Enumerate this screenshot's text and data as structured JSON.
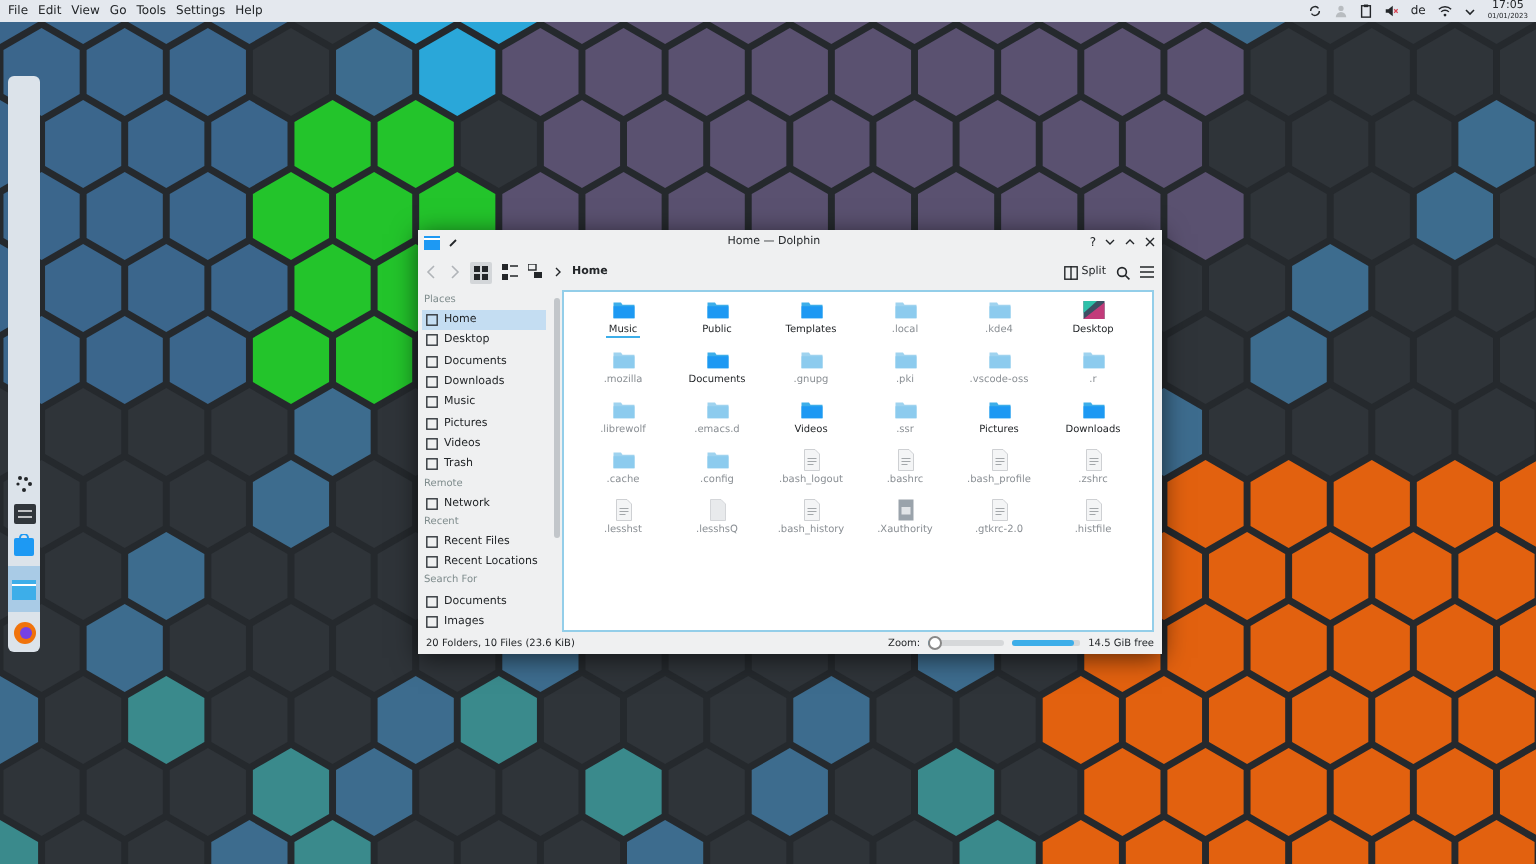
{
  "panel": {
    "menu": [
      "File",
      "Edit",
      "View",
      "Go",
      "Tools",
      "Settings",
      "Help"
    ],
    "keyboard_layout": "de",
    "time": "17:05",
    "date": "01/01/2023"
  },
  "window": {
    "title": "Home — Dolphin",
    "help": "?"
  },
  "toolbar": {
    "breadcrumb": "Home",
    "split": "Split"
  },
  "sidebar": {
    "sections": [
      {
        "title": "Places",
        "items": [
          {
            "label": "Home",
            "selected": true
          },
          {
            "label": "Desktop",
            "selected": false
          },
          {
            "label": "Documents",
            "selected": false
          },
          {
            "label": "Downloads",
            "selected": false
          },
          {
            "label": "Music",
            "selected": false
          },
          {
            "label": "Pictures",
            "selected": false
          },
          {
            "label": "Videos",
            "selected": false
          },
          {
            "label": "Trash",
            "selected": false
          }
        ]
      },
      {
        "title": "Remote",
        "items": [
          {
            "label": "Network",
            "selected": false
          }
        ]
      },
      {
        "title": "Recent",
        "items": [
          {
            "label": "Recent Files",
            "selected": false
          },
          {
            "label": "Recent Locations",
            "selected": false
          }
        ]
      },
      {
        "title": "Search For",
        "items": [
          {
            "label": "Documents",
            "selected": false
          },
          {
            "label": "Images",
            "selected": false
          }
        ]
      }
    ]
  },
  "files": [
    {
      "name": "Music",
      "kind": "folder",
      "hidden": false,
      "selected": true
    },
    {
      "name": "Public",
      "kind": "folder",
      "hidden": false,
      "selected": false
    },
    {
      "name": "Templates",
      "kind": "folder",
      "hidden": false,
      "selected": false
    },
    {
      "name": ".local",
      "kind": "folder",
      "hidden": true,
      "selected": false
    },
    {
      "name": ".kde4",
      "kind": "folder",
      "hidden": true,
      "selected": false
    },
    {
      "name": "Desktop",
      "kind": "desktop",
      "hidden": false,
      "selected": false
    },
    {
      "name": ".mozilla",
      "kind": "folder",
      "hidden": true,
      "selected": false
    },
    {
      "name": "Documents",
      "kind": "folder",
      "hidden": false,
      "selected": false
    },
    {
      "name": ".gnupg",
      "kind": "folder",
      "hidden": true,
      "selected": false
    },
    {
      "name": ".pki",
      "kind": "folder",
      "hidden": true,
      "selected": false
    },
    {
      "name": ".vscode-oss",
      "kind": "folder",
      "hidden": true,
      "selected": false
    },
    {
      "name": ".r",
      "kind": "folder",
      "hidden": true,
      "selected": false
    },
    {
      "name": ".librewolf",
      "kind": "folder",
      "hidden": true,
      "selected": false
    },
    {
      "name": ".emacs.d",
      "kind": "folder",
      "hidden": true,
      "selected": false
    },
    {
      "name": "Videos",
      "kind": "folder",
      "hidden": false,
      "selected": false
    },
    {
      "name": ".ssr",
      "kind": "folder",
      "hidden": true,
      "selected": false
    },
    {
      "name": "Pictures",
      "kind": "folder",
      "hidden": false,
      "selected": false
    },
    {
      "name": "Downloads",
      "kind": "folder",
      "hidden": false,
      "selected": false
    },
    {
      "name": ".cache",
      "kind": "folder",
      "hidden": true,
      "selected": false
    },
    {
      "name": ".config",
      "kind": "folder",
      "hidden": true,
      "selected": false
    },
    {
      "name": ".bash_logout",
      "kind": "file",
      "hidden": true,
      "selected": false
    },
    {
      "name": ".bashrc",
      "kind": "file",
      "hidden": true,
      "selected": false
    },
    {
      "name": ".bash_profile",
      "kind": "file",
      "hidden": true,
      "selected": false
    },
    {
      "name": ".zshrc",
      "kind": "file",
      "hidden": true,
      "selected": false
    },
    {
      "name": ".lesshst",
      "kind": "file",
      "hidden": true,
      "selected": false
    },
    {
      "name": ".lesshsQ",
      "kind": "blank",
      "hidden": true,
      "selected": false
    },
    {
      "name": ".bash_history",
      "kind": "file",
      "hidden": true,
      "selected": false
    },
    {
      "name": ".Xauthority",
      "kind": "binary",
      "hidden": true,
      "selected": false
    },
    {
      "name": ".gtkrc-2.0",
      "kind": "file",
      "hidden": true,
      "selected": false
    },
    {
      "name": ".histfile",
      "kind": "file",
      "hidden": true,
      "selected": false
    }
  ],
  "status_bar": {
    "summary": "20 Folders, 10 Files (23.6 KiB)",
    "zoom_label": "Zoom:",
    "zoom": {
      "level": 0.08
    },
    "disk": {
      "level": 0.92
    },
    "free": "14.5 GiB free"
  }
}
